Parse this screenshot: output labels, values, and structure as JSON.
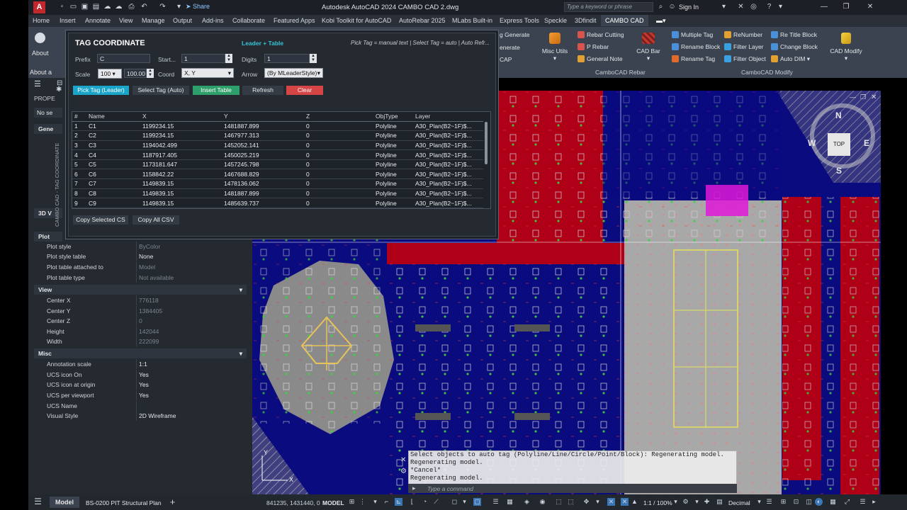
{
  "titlebar": {
    "app_logo": "A",
    "share": "Share",
    "title": "Autodesk AutoCAD 2024    CAMBO CAD 2.dwg",
    "search_placeholder": "Type a keyword or phrase",
    "signin": "Sign In"
  },
  "ribbon_tabs": [
    "Home",
    "Insert",
    "Annotate",
    "View",
    "Manage",
    "Output",
    "Add-ins",
    "Collaborate",
    "Featured Apps",
    "Kobi Toolkit for AutoCAD",
    "AutoRebar 2025",
    "MLabs Built-in",
    "Express Tools",
    "Speckle",
    "3Dfindit",
    "CAMBO CAD"
  ],
  "ribbon": {
    "left_items": [
      "g Generate",
      "enerate",
      "CAP"
    ],
    "misc_utils": "Misc Utils",
    "rebar_panel": {
      "items": [
        "Rebar Cutting",
        "P Rebar",
        "General Note"
      ],
      "big": "CAD Bar",
      "label": "CamboCAD Rebar"
    },
    "modify_panel": {
      "col1": [
        "Multiple Tag",
        "Rename Block",
        "Rename Tag"
      ],
      "col2": [
        "ReNumber",
        "Filter Layer",
        "Filter Object"
      ],
      "col3": [
        "Re Title Block",
        "Change Block",
        "Auto DIM"
      ],
      "big": "CAD Modify",
      "label": "CamboCAD Modify"
    }
  },
  "left_panel": {
    "about": "About",
    "about_a": "About a",
    "props_header": "PROPE",
    "no_sel": "No se",
    "gen": "Gene",
    "view3d": "3D V",
    "plot": "Plot"
  },
  "properties": {
    "plot_rows": [
      {
        "k": "Plot style",
        "v": "ByColor",
        "dim": true
      },
      {
        "k": "Plot style table",
        "v": "None",
        "dim": false
      },
      {
        "k": "Plot table attached to",
        "v": "Model",
        "dim": true
      },
      {
        "k": "Plot table type",
        "v": "Not available",
        "dim": true
      }
    ],
    "view_title": "View",
    "view_rows": [
      {
        "k": "Center X",
        "v": "776118",
        "dim": true
      },
      {
        "k": "Center Y",
        "v": "1384405",
        "dim": true
      },
      {
        "k": "Center Z",
        "v": "0",
        "dim": true
      },
      {
        "k": "Height",
        "v": "142044",
        "dim": true
      },
      {
        "k": "Width",
        "v": "222099",
        "dim": true
      }
    ],
    "misc_title": "Misc",
    "misc_rows": [
      {
        "k": "Annotation scale",
        "v": "1:1",
        "dim": false
      },
      {
        "k": "UCS icon On",
        "v": "Yes",
        "dim": false
      },
      {
        "k": "UCS icon at origin",
        "v": "Yes",
        "dim": false
      },
      {
        "k": "UCS per viewport",
        "v": "Yes",
        "dim": false
      },
      {
        "k": "UCS Name",
        "v": "",
        "dim": false
      },
      {
        "k": "Visual Style",
        "v": "2D Wireframe",
        "dim": false
      }
    ]
  },
  "dialog": {
    "title": "TAG COORDINATE",
    "mode": "Leader + Table",
    "hint": "Pick Tag = manual text | Select Tag = auto | Auto Refr...",
    "vertical_label": "CAMBO CAD - TAG COORDINATE",
    "prefix_label": "Prefix",
    "prefix_value": "C",
    "start_label": "Start...",
    "start_value": "1",
    "digits_label": "Digits",
    "digits_value": "1",
    "scale_label": "Scale",
    "scale_value": "100",
    "scale_value2": "100.00",
    "coord_label": "Coord",
    "coord_value": "X, Y",
    "arrow_label": "Arrow",
    "arrow_value": "(By MLeaderStyle)",
    "buttons": {
      "pick": "Pick Tag (Leader)",
      "select": "Select Tag (Auto)",
      "insert": "Insert Table",
      "refresh": "Refresh",
      "clear": "Clear",
      "copy_selected": "Copy  Selected CS",
      "copy_all": "Copy All CSV"
    },
    "columns": [
      "#",
      "Name",
      "X",
      "Y",
      "Z",
      "ObjType",
      "Layer"
    ],
    "rows": [
      [
        "1",
        "C1",
        "1199234.15",
        "1481887.899",
        "0",
        "Polyline",
        "A30_Plan(B2~1F)$..."
      ],
      [
        "2",
        "C2",
        "1199234.15",
        "1467977.313",
        "0",
        "Polyline",
        "A30_Plan(B2~1F)$..."
      ],
      [
        "3",
        "C3",
        "1194042.499",
        "1452052.141",
        "0",
        "Polyline",
        "A30_Plan(B2~1F)$..."
      ],
      [
        "4",
        "C4",
        "1187917.405",
        "1450025.219",
        "0",
        "Polyline",
        "A30_Plan(B2~1F)$..."
      ],
      [
        "5",
        "C5",
        "1173181.647",
        "1457245.798",
        "0",
        "Polyline",
        "A30_Plan(B2~1F)$..."
      ],
      [
        "6",
        "C6",
        "1158842.22",
        "1467688.829",
        "0",
        "Polyline",
        "A30_Plan(B2~1F)$..."
      ],
      [
        "7",
        "C7",
        "1149839.15",
        "1478136.062",
        "0",
        "Polyline",
        "A30_Plan(B2~1F)$..."
      ],
      [
        "8",
        "C8",
        "1149839.15",
        "1481887.899",
        "0",
        "Polyline",
        "A30_Plan(B2~1F)$..."
      ],
      [
        "9",
        "C9",
        "1149839.15",
        "1485639.737",
        "0",
        "Polyline",
        "A30_Plan(B2~1F)$..."
      ]
    ]
  },
  "viewcube": {
    "n": "N",
    "w": "W",
    "e": "E",
    "s": "S",
    "top": "TOP"
  },
  "command_line": {
    "lines": [
      "Select objects to auto tag (Polyline/Line/Circle/Point/Block):  Regenerating model.",
      "Regenerating model.",
      "*Cancel*",
      "Regenerating model."
    ],
    "placeholder": "Type a command"
  },
  "statusbar": {
    "model_tab": "Model",
    "layout_tab": "BS-0200 PIT Structural Plan",
    "coords": "841235, 1431440, 0",
    "model_label": "MODEL",
    "scale": "1:1 / 100%",
    "units": "Decimal"
  },
  "colors": {
    "accent_teal": "#35c3d8",
    "pick_btn": "#1aa4c8",
    "insert_btn": "#2e9e6a",
    "clear_btn": "#d64545",
    "canvas_blue": "#0b0b80",
    "canvas_red": "#b00018"
  }
}
